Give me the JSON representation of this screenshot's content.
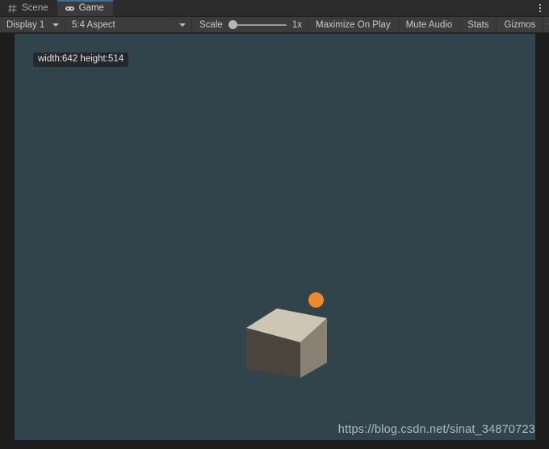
{
  "window": {
    "tabs": [
      {
        "label": "Scene",
        "icon": "grid-icon",
        "active": false
      },
      {
        "label": "Game",
        "icon": "gamepad-icon",
        "active": true
      }
    ],
    "menu_icon": "kebab-menu-icon"
  },
  "toolbar": {
    "display": {
      "label": "Display 1",
      "icon": "chevron-down-icon"
    },
    "aspect": {
      "label": "5:4 Aspect",
      "icon": "chevron-down-icon"
    },
    "scale": {
      "label": "Scale",
      "value": "1x",
      "percent": 0
    },
    "maximize_on_play": "Maximize On Play",
    "mute_audio": "Mute Audio",
    "stats": "Stats",
    "gizmos": "Gizmos",
    "gizmos_caret_icon": "chevron-down-icon"
  },
  "gameview": {
    "size_label": "width:642 height:514",
    "background_color": "#31434b",
    "objects": {
      "cube": {
        "name": "cube",
        "top_color": "#cdc6b4",
        "left_color": "#4a453c",
        "right_color": "#8a8175"
      },
      "sphere": {
        "name": "sphere",
        "color": "#f08927"
      }
    },
    "watermark": "https://blog.csdn.net/sinat_34870723"
  }
}
